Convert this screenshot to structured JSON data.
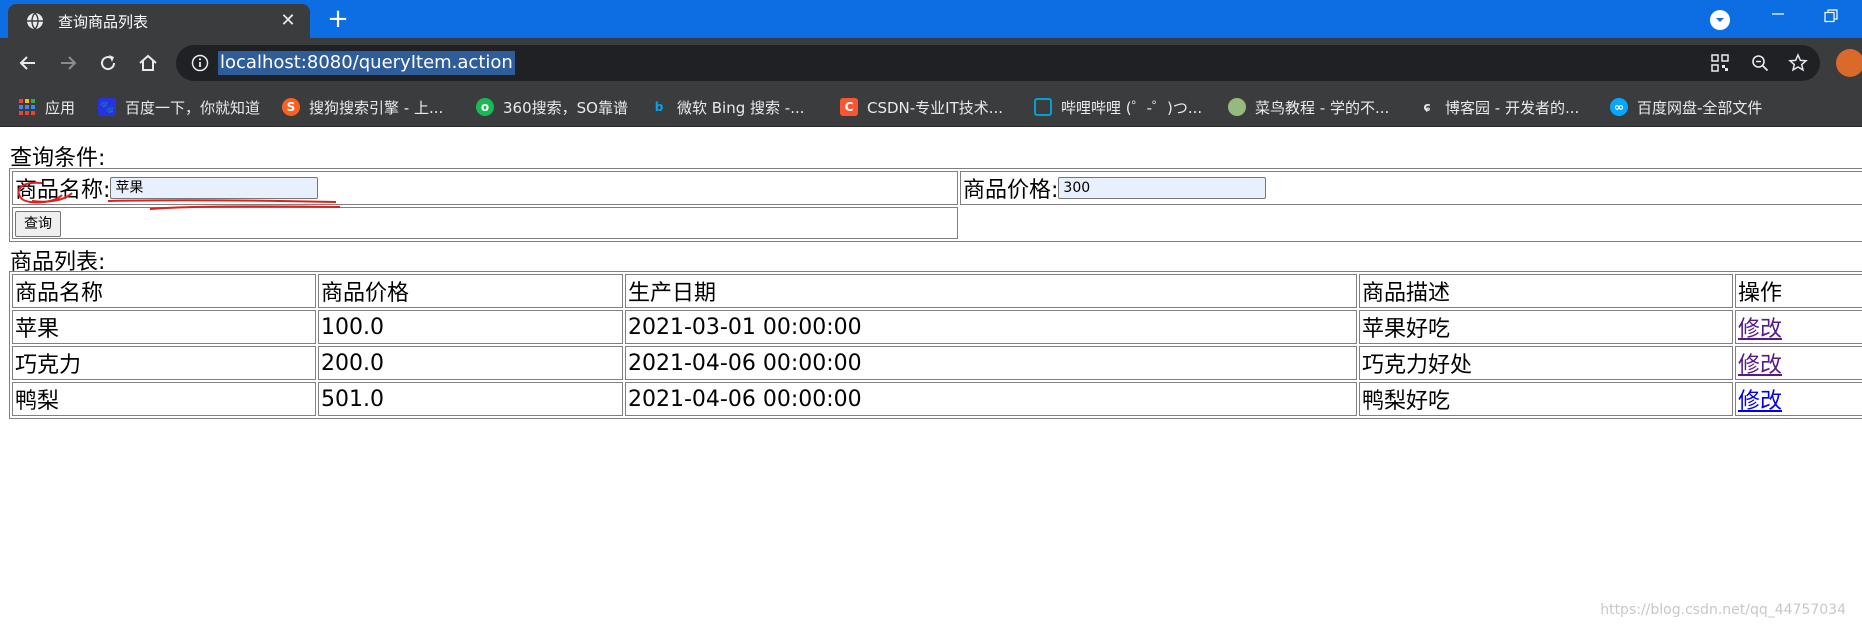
{
  "browser": {
    "tab_title": "查询商品列表",
    "url": "localhost:8080/queryItem.action"
  },
  "bookmarks": [
    {
      "label": "应用",
      "icon": "apps-grid-icon",
      "color": "#4285f4"
    },
    {
      "label": "百度一下，你就知道",
      "icon": "baidu-icon",
      "color": "#2932e1"
    },
    {
      "label": "搜狗搜索引擎 - 上...",
      "icon": "sogou-icon",
      "color": "#fb6022"
    },
    {
      "label": "360搜索，SO靠谱",
      "icon": "so360-icon",
      "color": "#19b955"
    },
    {
      "label": "微软 Bing 搜索 -...",
      "icon": "bing-icon",
      "color": "#00a4ef"
    },
    {
      "label": "CSDN-专业IT技术...",
      "icon": "csdn-icon",
      "color": "#fc5531"
    },
    {
      "label": "哔哩哔哩 (゜-゜)つ...",
      "icon": "bilibili-icon",
      "color": "#00a1d6"
    },
    {
      "label": "菜鸟教程 - 学的不...",
      "icon": "runoob-icon",
      "color": "#96b97d"
    },
    {
      "label": "博客园 - 开发者的...",
      "icon": "cnblogs-icon",
      "color": "#9aa0a6"
    },
    {
      "label": "百度网盘-全部文件",
      "icon": "baidu-netdisk-icon",
      "color": "#06a7ff"
    }
  ],
  "query": {
    "title": "查询条件:",
    "name_label": "商品名称:",
    "name_value": "苹果",
    "price_label": "商品价格:",
    "price_value": "300",
    "button_label": "查询"
  },
  "list": {
    "title": "商品列表:",
    "columns": [
      "商品名称",
      "商品价格",
      "生产日期",
      "商品描述",
      "操作"
    ],
    "rows": [
      {
        "name": "苹果",
        "price": "100.0",
        "date": "2021-03-01 00:00:00",
        "desc": "苹果好吃",
        "action": "修改"
      },
      {
        "name": "巧克力",
        "price": "200.0",
        "date": "2021-04-06 00:00:00",
        "desc": "巧克力好处",
        "action": "修改"
      },
      {
        "name": "鸭梨",
        "price": "501.0",
        "date": "2021-04-06 00:00:00",
        "desc": "鸭梨好吃",
        "action": "修改"
      }
    ]
  },
  "watermark": "https://blog.csdn.net/qq_44757034",
  "colors": {
    "tabbar": "#0d6ee3",
    "chrome": "#3b3c3e",
    "annotation": "#e0201c",
    "visited_link": "#551a8b",
    "link": "#0000ee"
  }
}
